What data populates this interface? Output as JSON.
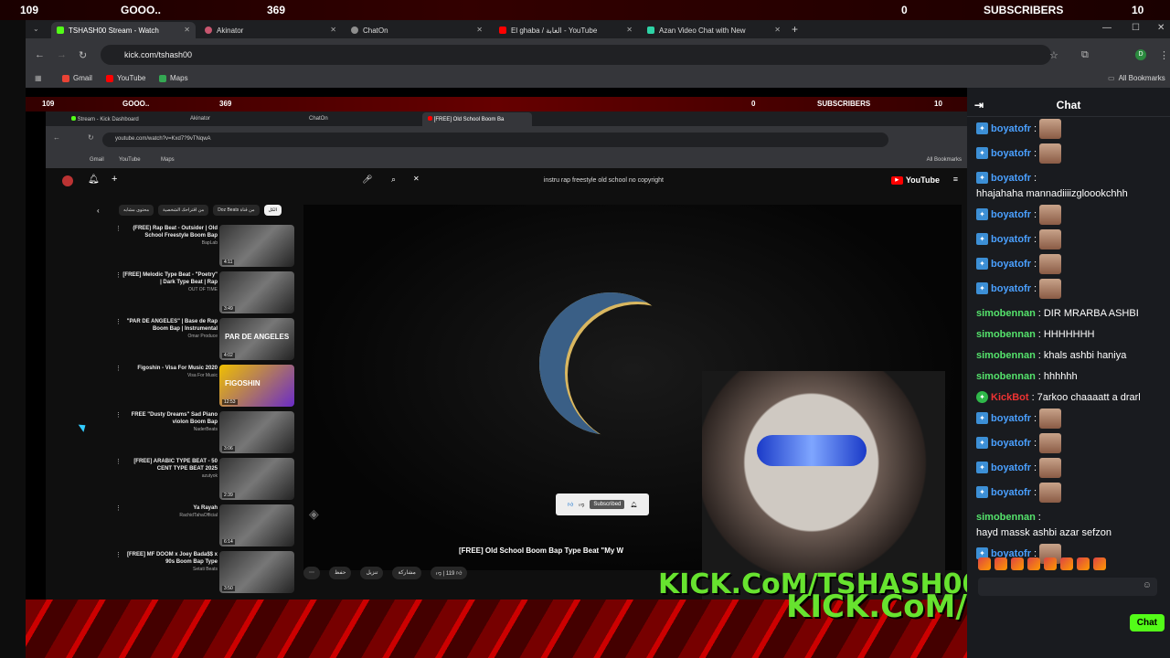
{
  "overlay": {
    "left_count": "109",
    "goal": "GOOO..",
    "goal_count": "369",
    "mid_count": "0",
    "subscribers_label": "SUBSCRIBERS",
    "subscribers_count": "10"
  },
  "browser": {
    "tabs": [
      {
        "label": "TSHASH00 Stream - Watch",
        "color": "#53fc18"
      },
      {
        "label": "Akinator",
        "color": "#c7566f"
      },
      {
        "label": "ChatOn",
        "color": "#8e8e8e"
      },
      {
        "label": "El ghaba / الغابة - YouTube",
        "color": "#ff0000"
      },
      {
        "label": "Azan Video Chat with New",
        "color": "#2ed3a6"
      }
    ],
    "url": "kick.com/tshash00",
    "bookmarks": [
      "Gmail",
      "YouTube",
      "Maps"
    ],
    "all_bookmarks": "All Bookmarks"
  },
  "inner_browser": {
    "tabs": [
      "Stream - Kick Dashboard",
      "Akinator",
      "ChatOn",
      "[FREE] Old School Boom Ba"
    ],
    "url": "youtube.com/watch?v=Kxd7?9vTNqwA",
    "bookmarks": [
      "Gmail",
      "YouTube",
      "Maps"
    ],
    "all_bookmarks": "All Bookmarks"
  },
  "youtube": {
    "search_query": "instru rap freestyle old school no copyright",
    "logo": "YouTube",
    "chips": [
      "الكل",
      "من قناة Doz Beats",
      "من اقتراحك الشخصية",
      "محتوى مشابه"
    ],
    "recommendations": [
      {
        "title": "(FREE) Rap Beat - Outsider | Old School Freestyle Boom Bap",
        "channel": "BapLab",
        "duration": "4:11"
      },
      {
        "title": "[FREE] Melodic Type Beat - \"Poetry\" | Dark Type Beat | Rap",
        "channel": "OUT OF TIME",
        "duration": "3:49"
      },
      {
        "title": "\"PAR DE ANGELES\" | Base de Rap Boom Bap | Instrumental",
        "channel": "Omar Produce",
        "duration": "4:02",
        "thumb_text": "PAR DE ANGELES"
      },
      {
        "title": "Figoshin - Visa For Music 2020",
        "channel": "Visa For Music",
        "duration": "12:53",
        "thumb_text": "FIGOSHIN"
      },
      {
        "title": "FREE \"Dusty Dreams\" Sad Piano violon Boom Bap",
        "channel": "NaderBeats",
        "duration": "3:06"
      },
      {
        "title": "[FREE] ARABIC TYPE BEAT - 50 CENT TYPE BEAT 2025",
        "channel": "azutyok",
        "duration": "2:39"
      },
      {
        "title": "Ya Rayah",
        "channel": "RachidTahaOfficial",
        "duration": "6:14"
      },
      {
        "title": "[FREE] MF DOOM x Joey Bada$$ x 90s Boom Bap Type",
        "channel": "Setati Beats",
        "duration": "3:50"
      }
    ],
    "video_title": "[FREE] Old School Boom Bap Type Beat \"My W",
    "subscribed": "Subscribed",
    "actions": [
      "119",
      "مشاركة",
      "تنزيل",
      "حفظ"
    ]
  },
  "stream_overlay": {
    "kick_text_1": "KICK.CoM/TSHASH00",
    "kick_text_2": "KICK.CoM/TSHASH00"
  },
  "chat": {
    "title": "Chat",
    "messages": [
      {
        "user": "boyatofr",
        "text": "",
        "emote": true,
        "kind": "b"
      },
      {
        "user": "boyatofr",
        "text": "",
        "emote": true,
        "kind": "b"
      },
      {
        "user": "boyatofr",
        "text": "hhajahaha mannadiiiizgloookchhh",
        "emote": false,
        "kind": "b"
      },
      {
        "user": "boyatofr",
        "text": "",
        "emote": true,
        "kind": "b"
      },
      {
        "user": "boyatofr",
        "text": "",
        "emote": true,
        "kind": "b"
      },
      {
        "user": "boyatofr",
        "text": "",
        "emote": true,
        "kind": "b"
      },
      {
        "user": "boyatofr",
        "text": "",
        "emote": true,
        "kind": "b"
      },
      {
        "user": "simobennan",
        "text": "DIR MRARBA ASHBI",
        "emote": false,
        "kind": "s"
      },
      {
        "user": "simobennan",
        "text": "HHHHHHH",
        "emote": false,
        "kind": "s"
      },
      {
        "user": "simobennan",
        "text": "khals ashbi haniya",
        "emote": false,
        "kind": "s"
      },
      {
        "user": "simobennan",
        "text": "hhhhhh",
        "emote": false,
        "kind": "s"
      },
      {
        "user": "KickBot",
        "text": "7arkoo chaaaatt a drarl",
        "emote": false,
        "kind": "k"
      },
      {
        "user": "boyatofr",
        "text": "",
        "emote": true,
        "kind": "b"
      },
      {
        "user": "boyatofr",
        "text": "",
        "emote": true,
        "kind": "b"
      },
      {
        "user": "boyatofr",
        "text": "",
        "emote": true,
        "kind": "b"
      },
      {
        "user": "boyatofr",
        "text": "",
        "emote": true,
        "kind": "b"
      },
      {
        "user": "simobennan",
        "text": "hayd massk ashbi azar sefzon",
        "emote": false,
        "kind": "s"
      },
      {
        "user": "boyatofr",
        "text": "",
        "emote": true,
        "kind": "b"
      }
    ],
    "send_label": "Chat"
  }
}
